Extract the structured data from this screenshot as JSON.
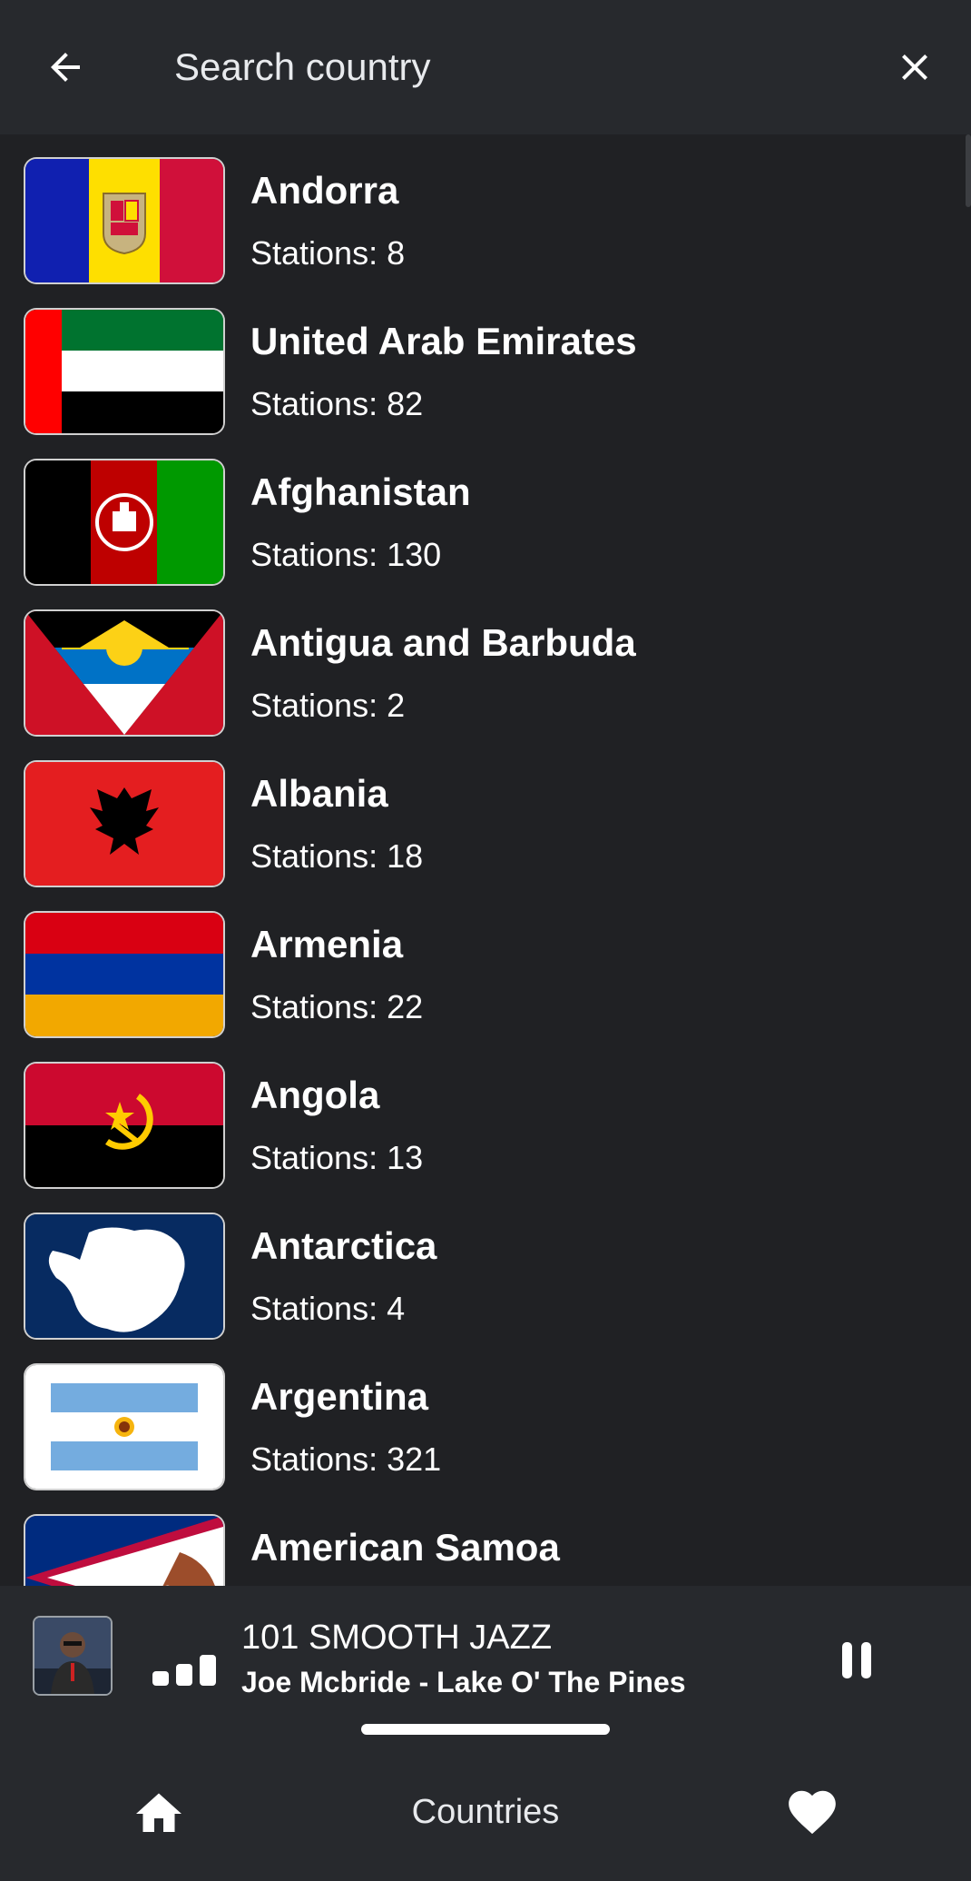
{
  "search": {
    "placeholder": "Search country"
  },
  "icons": {
    "back": "arrow-back-icon",
    "close": "close-icon",
    "home": "home-icon",
    "favorites": "heart-icon",
    "pause": "pause-icon",
    "signal": "signal-bars-icon"
  },
  "countries": [
    {
      "name": "Andorra",
      "stations": "Stations: 8"
    },
    {
      "name": "United Arab Emirates",
      "stations": "Stations: 82"
    },
    {
      "name": "Afghanistan",
      "stations": "Stations: 130"
    },
    {
      "name": "Antigua and Barbuda",
      "stations": "Stations: 2"
    },
    {
      "name": "Albania",
      "stations": "Stations: 18"
    },
    {
      "name": "Armenia",
      "stations": "Stations: 22"
    },
    {
      "name": "Angola",
      "stations": "Stations: 13"
    },
    {
      "name": "Antarctica",
      "stations": "Stations: 4"
    },
    {
      "name": "Argentina",
      "stations": "Stations: 321"
    },
    {
      "name": "American Samoa",
      "stations": ""
    }
  ],
  "player": {
    "station": "101 SMOOTH JAZZ",
    "track": "Joe Mcbride - Lake O' The Pines"
  },
  "nav": {
    "label": "Countries"
  },
  "colors": {
    "background": "#202124",
    "bar": "#27292d",
    "text": "#ffffff"
  }
}
